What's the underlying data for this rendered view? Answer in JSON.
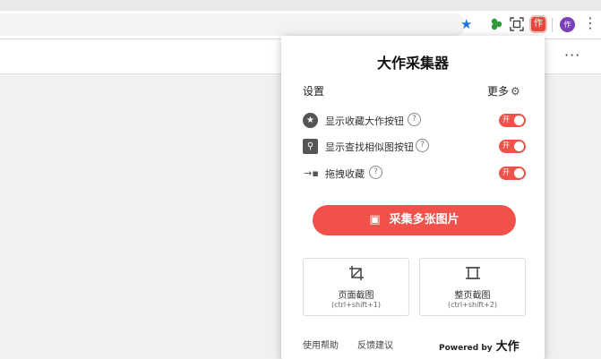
{
  "browser": {
    "avatar_text": "作",
    "ext_dazuo_text": "作",
    "menu_glyph": "⋮",
    "page_more": "···"
  },
  "popup": {
    "title": "大作采集器",
    "settings_label": "设置",
    "more_label": "更多",
    "rows": [
      {
        "icon": "star-icon",
        "label": "显示收藏大作按钮",
        "toggle_text": "开",
        "enabled": true
      },
      {
        "icon": "search-icon",
        "label": "显示查找相似图按钮",
        "toggle_text": "开",
        "enabled": true
      },
      {
        "icon": "drag-collect-icon",
        "label": "拖拽收藏",
        "toggle_text": "开",
        "enabled": true
      }
    ],
    "collect_button": "采集多张图片",
    "cards": [
      {
        "icon": "crop-icon",
        "title": "页面截图",
        "hint": "(ctrl+shift+1)"
      },
      {
        "icon": "fullpage-screenshot-icon",
        "title": "整页截图",
        "hint": "(ctrl+shift+2)"
      }
    ],
    "footer": {
      "help": "使用帮助",
      "feedback": "反馈建议",
      "powered_by": "Powered by",
      "brand": "大作"
    }
  },
  "colors": {
    "accent": "#f0514a",
    "star_blue": "#1a73e8",
    "avatar_purple": "#7b3fb8"
  }
}
